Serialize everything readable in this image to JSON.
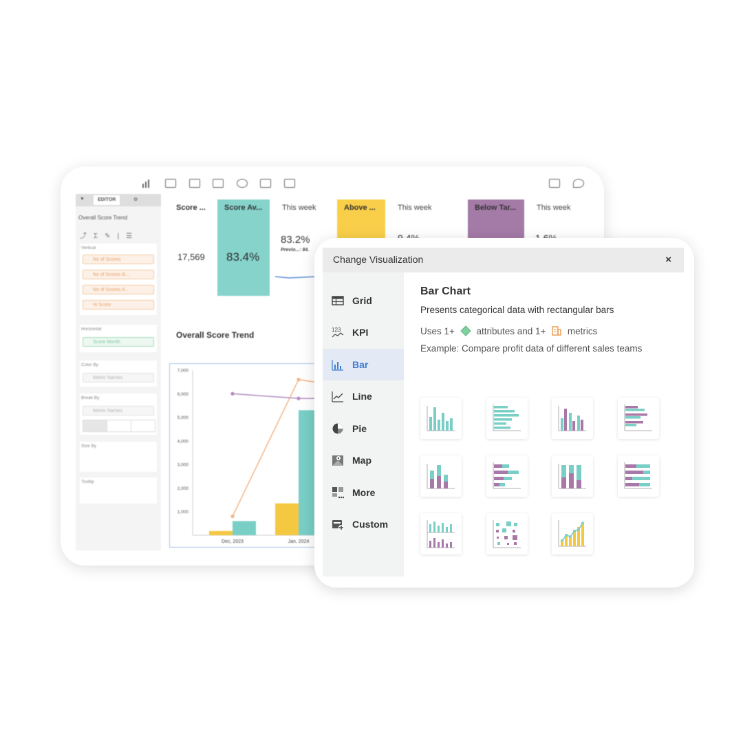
{
  "dashboard": {
    "sidebar": {
      "tab_editor": "EDITOR",
      "panel_title": "Overall Score Trend",
      "vertical_label": "Vertical",
      "vertical_items": [
        "No of Scores",
        "No of Scores B...",
        "No of Scores A...",
        "% Score"
      ],
      "horizontal_label": "Horizontal",
      "horizontal_item": "Score Month",
      "color_by_label": "Color By",
      "color_by_item": "Metric Names",
      "break_by_label": "Break By",
      "break_by_item": "Metric Names",
      "size_by_label": "Size By",
      "tooltip_label": "Tooltip"
    },
    "kpis": {
      "score_label": "Score ...",
      "score_value": "17,569",
      "score_avg_label": "Score Av...",
      "score_avg_value": "83.4%",
      "this_week_1": "This week",
      "this_week_1_value": "83.2%",
      "this_week_1_prev": "Previo...: 84.",
      "above_label": "Above ...",
      "this_week_2": "This week",
      "this_week_2_value": "9.4%",
      "below_label": "Below Tar...",
      "this_week_3": "This week",
      "this_week_3_value": "1.6%"
    },
    "chart_title": "Overall Score Trend",
    "chart_data": {
      "type": "bar",
      "categories": [
        "Dec, 2023",
        "Jan, 2024"
      ],
      "yticks": [
        "7,000",
        "6,000",
        "5,000",
        "4,000",
        "3,000",
        "2,000",
        "1,000"
      ],
      "ylim": [
        0,
        7000
      ],
      "series": [
        {
          "values": [
            180,
            1350
          ],
          "color": "#f5c842"
        },
        {
          "values": [
            600,
            5300
          ],
          "color": "#79cfc6"
        },
        {
          "values": [
            800,
            6600
          ],
          "color": "#f3b383"
        },
        {
          "values": [
            6000,
            5800
          ],
          "color": "#b28ac0"
        }
      ]
    }
  },
  "modal": {
    "title": "Change Visualization",
    "close": "×",
    "menu": [
      {
        "label": "Grid",
        "icon": "grid-icon"
      },
      {
        "label": "KPI",
        "icon": "kpi-icon"
      },
      {
        "label": "Bar",
        "icon": "bar-icon",
        "active": true
      },
      {
        "label": "Line",
        "icon": "line-icon"
      },
      {
        "label": "Pie",
        "icon": "pie-icon"
      },
      {
        "label": "Map",
        "icon": "map-icon"
      },
      {
        "label": "More",
        "icon": "more-icon"
      },
      {
        "label": "Custom",
        "icon": "custom-icon"
      }
    ],
    "content": {
      "title": "Bar Chart",
      "description": "Presents categorical data with rectangular bars",
      "uses_prefix": "Uses 1+",
      "uses_attributes": "attributes and 1+",
      "uses_metrics": "metrics",
      "example": "Example: Compare profit data of different sales teams"
    },
    "thumbnails": [
      "vertical-bar-thumb",
      "horizontal-bar-thumb",
      "clustered-bar-thumb",
      "clustered-horizontal-bar-thumb",
      "stacked-bar-thumb",
      "stacked-horizontal-bar-thumb",
      "percent-stacked-bar-thumb",
      "percent-stacked-horizontal-bar-thumb",
      "dual-axis-bar-thumb",
      "dot-matrix-thumb",
      "combo-bar-line-thumb"
    ],
    "colors": {
      "teal": "#79cfc6",
      "purple": "#a878a8",
      "yellow": "#f5c842",
      "accent": "#3f7bcf"
    }
  },
  "chart_data": {
    "type": "bar",
    "categories": [
      "Dec, 2023",
      "Jan, 2024"
    ],
    "yticks": [
      "7,000",
      "6,000",
      "5,000",
      "4,000",
      "3,000",
      "2,000",
      "1,000"
    ],
    "ylim": [
      0,
      7000
    ],
    "series": [
      {
        "values": [
          180,
          1350
        ]
      },
      {
        "values": [
          600,
          5300
        ]
      },
      {
        "values": [
          800,
          6600
        ]
      },
      {
        "values": [
          6000,
          5800
        ]
      }
    ]
  }
}
